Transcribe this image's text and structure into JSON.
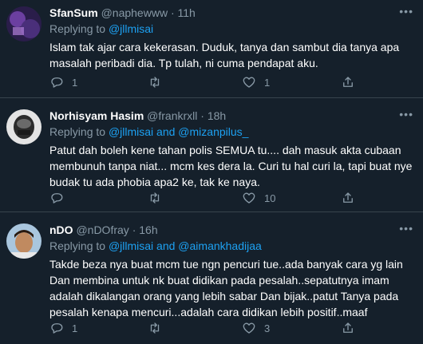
{
  "replying_prefix": "Replying to",
  "and_word": "and",
  "tweets": [
    {
      "name": "SfanSum",
      "handle": "@naphewww",
      "separator": "·",
      "time": "11h",
      "mentions": [
        "@jllmisai"
      ],
      "text": "Islam tak ajar cara kekerasan. Duduk, tanya dan sambut dia tanya apa masalah peribadi dia. Tp tulah, ni cuma pendapat aku.",
      "reply_count": "1",
      "retweet_count": "",
      "like_count": "1",
      "avatar_colors": [
        "#6b3fa0",
        "#2a1d4a"
      ]
    },
    {
      "name": "Norhisyam Hasim",
      "handle": "@frankrxll",
      "separator": "·",
      "time": "18h",
      "mentions": [
        "@jllmisai",
        "@mizanpilus_"
      ],
      "text": "Patut dah boleh kene tahan polis SEMUA tu.... dah masuk akta cubaan membunuh tanpa niat... mcm kes dera la. Curi tu hal curi la, tapi buat nye budak tu ada phobia apa2 ke, tak ke naya.",
      "reply_count": "",
      "retweet_count": "",
      "like_count": "10",
      "avatar_colors": [
        "#d9d9d9",
        "#2b2b2b"
      ]
    },
    {
      "name": "nDO",
      "handle": "@nDOfray",
      "separator": "·",
      "time": "16h",
      "mentions": [
        "@jllmisai",
        "@aimankhadijaa"
      ],
      "text": "Takde beza nya buat mcm tue ngn pencuri tue..ada banyak cara yg lain Dan membina untuk nk buat didikan pada pesalah..sepatutnya imam adalah dikalangan orang yang lebih sabar Dan bijak..patut Tanya pada pesalah kenapa mencuri...adalah cara didikan lebih positif..maaf",
      "reply_count": "1",
      "retweet_count": "",
      "like_count": "3",
      "avatar_colors": [
        "#a9c6de",
        "#7a5a40"
      ]
    }
  ],
  "icons": [
    "reply-icon",
    "retweet-icon",
    "like-icon",
    "share-icon",
    "more-icon"
  ],
  "colors": {
    "background": "#15202b",
    "divider": "#38444d",
    "muted": "#8899a6",
    "accent": "#1da1f2",
    "text": "#ffffff"
  }
}
